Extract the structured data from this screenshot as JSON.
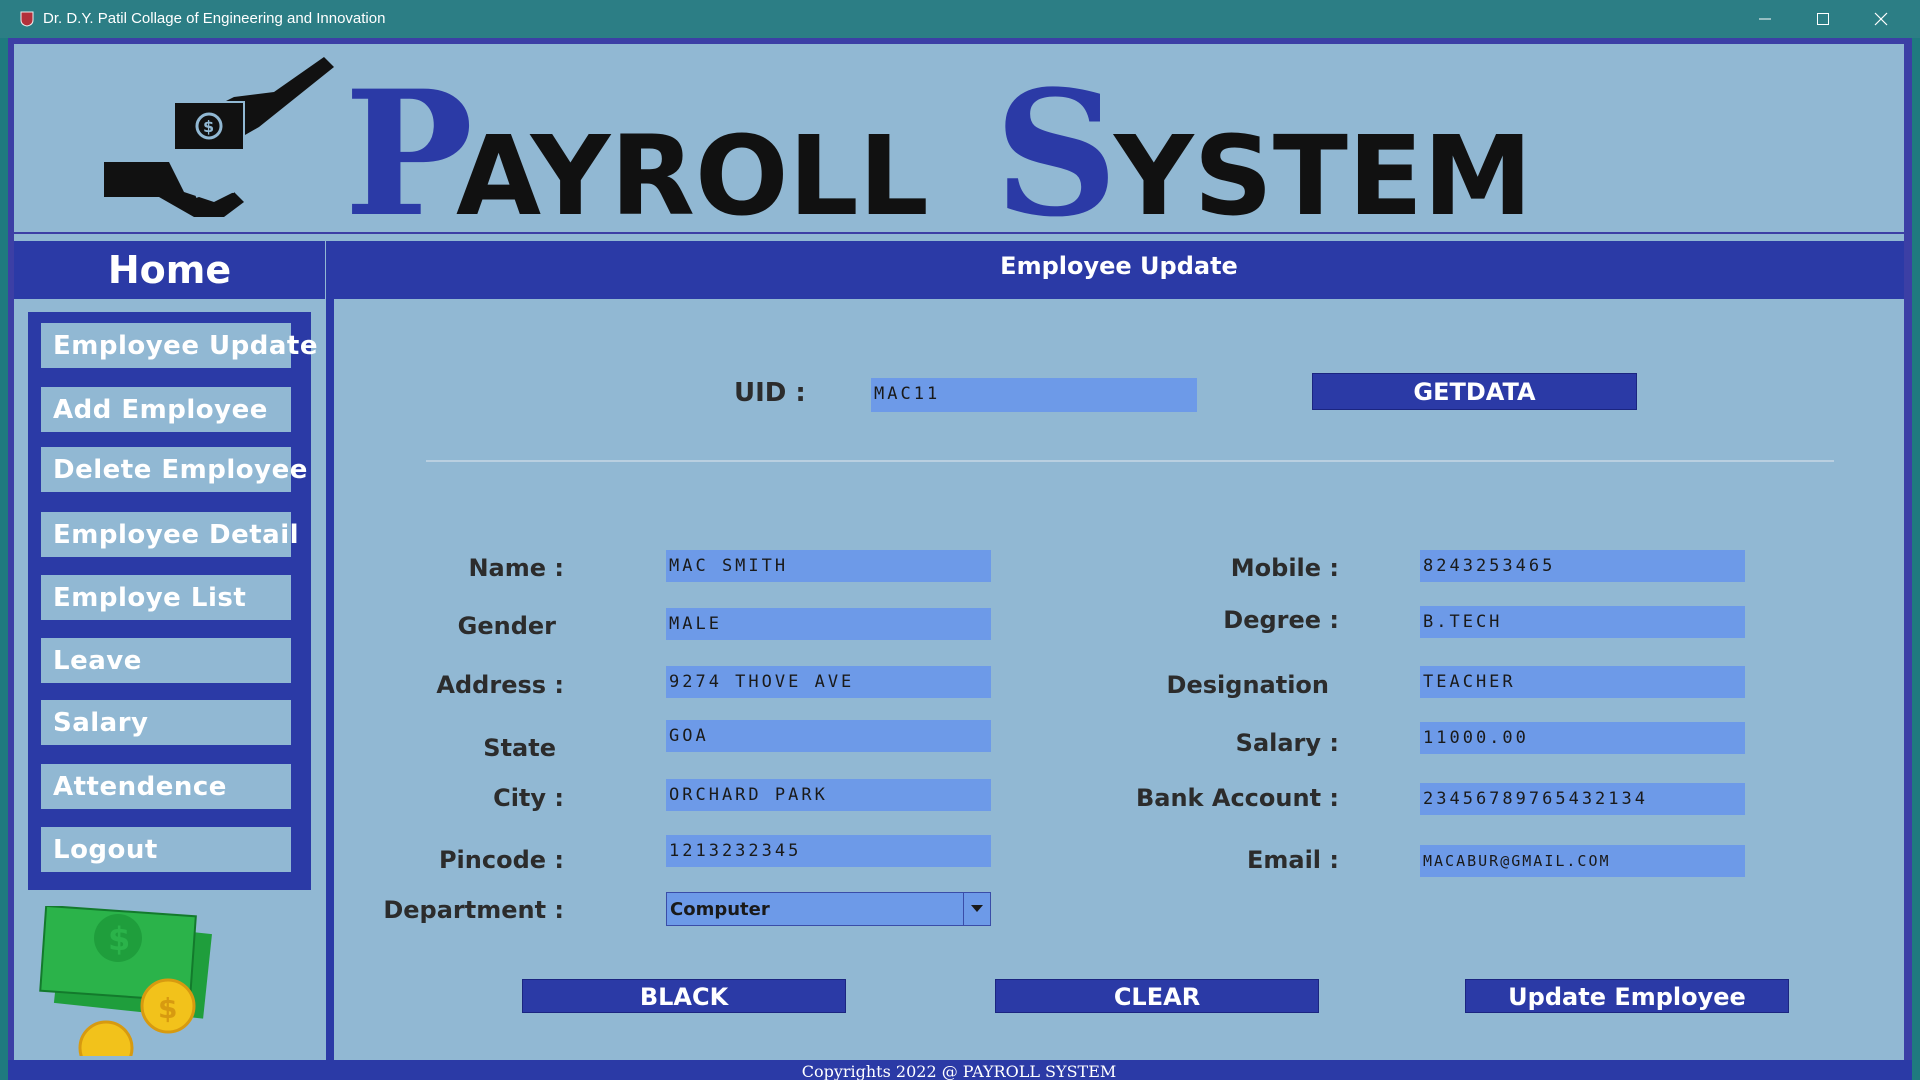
{
  "window": {
    "title": "Dr. D.Y. Patil Collage of Engineering and Innovation",
    "minimize_icon": "minimize-icon",
    "maximize_icon": "maximize-icon",
    "close_icon": "close-icon"
  },
  "banner": {
    "title_part1": "PAYROLL",
    "title_part2": "SYSTEM",
    "logo_icon": "payment-hands-icon",
    "title_color": "#2b3aa6"
  },
  "sidebar": {
    "home": "Home",
    "items": [
      {
        "label": "Employee Update"
      },
      {
        "label": "Add Employee"
      },
      {
        "label": "Delete Employee"
      },
      {
        "label": "Employee Detail"
      },
      {
        "label": "Employe List"
      },
      {
        "label": "Leave"
      },
      {
        "label": "Salary"
      },
      {
        "label": "Attendence"
      },
      {
        "label": "Logout"
      }
    ],
    "illustration": "money-cash-icon"
  },
  "main": {
    "title": "Employee Update",
    "uid_label": "UID :",
    "uid_value": "MAC11",
    "getdata_button": "GETDATA",
    "fields_left": [
      {
        "label": "Name :",
        "value": "MAC SMITH"
      },
      {
        "label": "Gender",
        "value": "MALE"
      },
      {
        "label": "Address :",
        "value": "9274 THOVE AVE"
      },
      {
        "label": "State",
        "value": "GOA"
      },
      {
        "label": "City :",
        "value": "ORCHARD PARK"
      },
      {
        "label": "Pincode :",
        "value": "1213232345"
      }
    ],
    "department": {
      "label": "Department :",
      "value": "Computer"
    },
    "fields_right": [
      {
        "label": "Mobile :",
        "value": "8243253465"
      },
      {
        "label": "Degree :",
        "value": "B.TECH"
      },
      {
        "label": "Designation",
        "value": "TEACHER"
      },
      {
        "label": "Salary :",
        "value": "11000.00"
      },
      {
        "label": "Bank Account :",
        "value": "23456789765432134"
      },
      {
        "label": "Email :",
        "value": "MACABUR@GMAIL.COM"
      }
    ],
    "buttons": {
      "back": "BLACK",
      "clear": "CLEAR",
      "update": "Update Employee"
    }
  },
  "footer": {
    "copyright": "Copyrights 2022 @ PAYROLL SYSTEM"
  },
  "colors": {
    "primary": "#2b3aa6",
    "background": "#91b8d3",
    "field": "#6d9ae8",
    "titlebar": "#2c7e85"
  }
}
